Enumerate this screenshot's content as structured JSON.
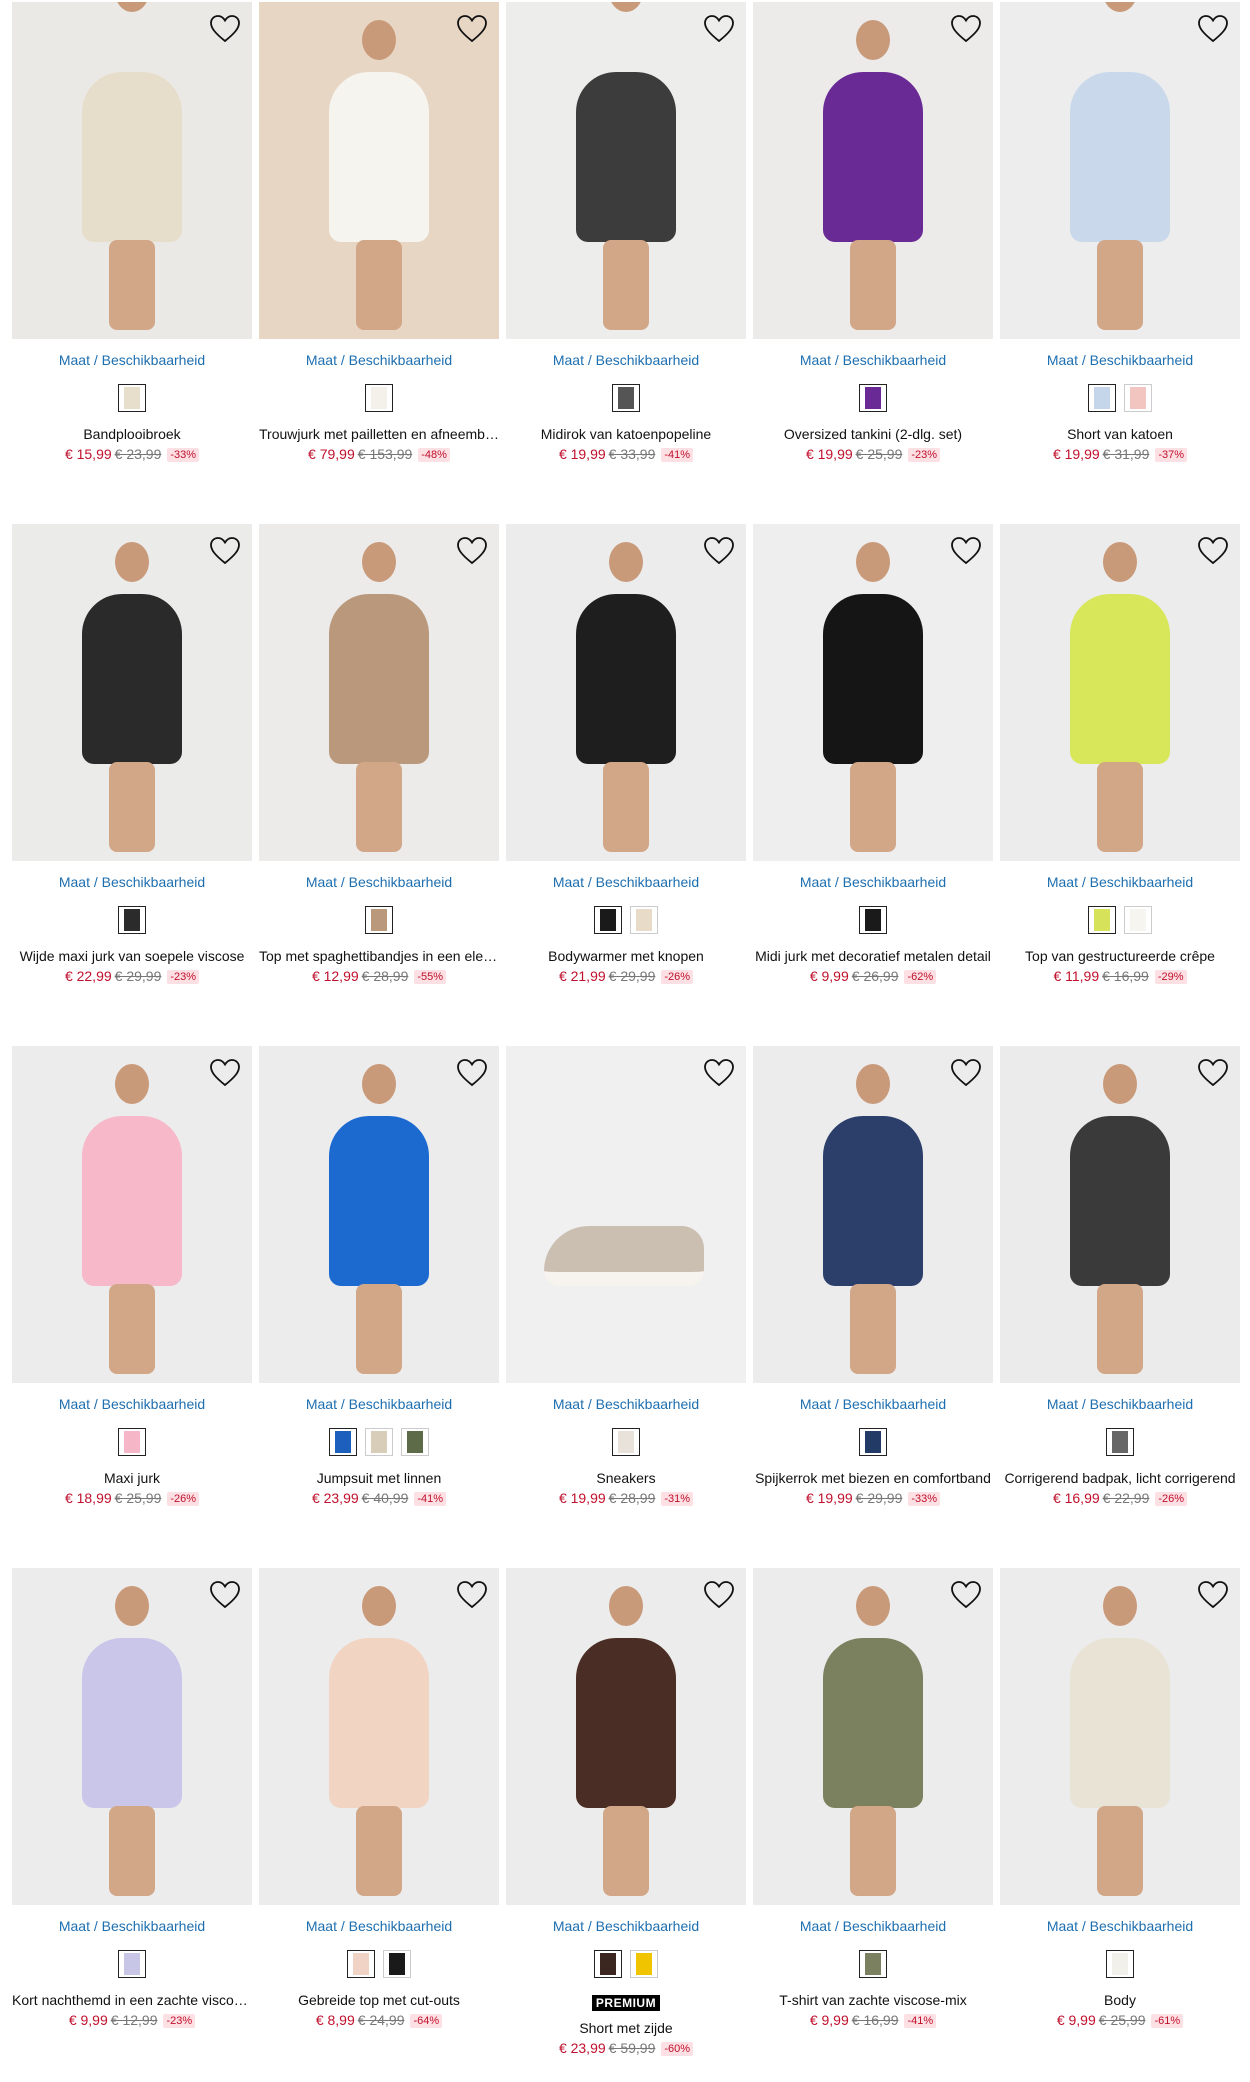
{
  "size_link_label": "Maat / Beschikbaarheid",
  "favorite_icon": "heart-outline-icon",
  "colors": {
    "price": "#c0102c",
    "old_price": "#777777",
    "discount_bg": "#fde0e3",
    "link": "#1e6fb0"
  },
  "products": [
    {
      "title": "Bandplooibroek",
      "price": "€ 15,99",
      "old_price": "€ 23,99",
      "discount": "-33%",
      "swatches": [
        "#e7dfcc"
      ],
      "photo_bg": "#ebe9e6",
      "garment": "#e6decb",
      "premium": false
    },
    {
      "title": "Trouwjurk met pailletten en afneembare rok",
      "price": "€ 79,99",
      "old_price": "€ 153,99",
      "discount": "-48%",
      "swatches": [
        "#f4f1ea"
      ],
      "photo_bg": "#e8d6c4",
      "garment": "#f6f4ee",
      "premium": false
    },
    {
      "title": "Midirok van katoenpopeline",
      "price": "€ 19,99",
      "old_price": "€ 33,99",
      "discount": "-41%",
      "swatches": [
        "#555555"
      ],
      "photo_bg": "#ededec",
      "garment": "#3c3c3c",
      "premium": false
    },
    {
      "title": "Oversized tankini (2-dlg. set)",
      "price": "€ 19,99",
      "old_price": "€ 25,99",
      "discount": "-23%",
      "swatches": [
        "#6a2a95"
      ],
      "photo_bg": "#ecebea",
      "garment": "#6a2a95",
      "premium": false
    },
    {
      "title": "Short van katoen",
      "price": "€ 19,99",
      "old_price": "€ 31,99",
      "discount": "-37%",
      "swatches": [
        "#c6d6ea",
        "#f2c5c0"
      ],
      "photo_bg": "#ededed",
      "garment": "#c9d8ea",
      "premium": false
    },
    {
      "title": "Wijde maxi jurk van soepele viscose",
      "price": "€ 22,99",
      "old_price": "€ 29,99",
      "discount": "-23%",
      "swatches": [
        "#2b2b2b"
      ],
      "photo_bg": "#ebebea",
      "garment": "#2a2a2a",
      "premium": false
    },
    {
      "title": "Top met spaghettibandjes in een elegante look",
      "price": "€ 12,99",
      "old_price": "€ 28,99",
      "discount": "-55%",
      "swatches": [
        "#b9987b"
      ],
      "photo_bg": "#ecebea",
      "garment": "#b9987b",
      "premium": false
    },
    {
      "title": "Bodywarmer met knopen",
      "price": "€ 21,99",
      "old_price": "€ 29,99",
      "discount": "-26%",
      "swatches": [
        "#1a1a1a",
        "#e8dcc8"
      ],
      "photo_bg": "#ececec",
      "garment": "#1e1e1e",
      "premium": false
    },
    {
      "title": "Midi jurk met decoratief metalen detail",
      "price": "€ 9,99",
      "old_price": "€ 26,99",
      "discount": "-62%",
      "swatches": [
        "#1a1a1a"
      ],
      "photo_bg": "#eeeeee",
      "garment": "#151515",
      "premium": false
    },
    {
      "title": "Top van gestructureerde crêpe",
      "price": "€ 11,99",
      "old_price": "€ 16,99",
      "discount": "-29%",
      "swatches": [
        "#d6e35a",
        "#f6f5f0"
      ],
      "photo_bg": "#ececec",
      "garment": "#d8e65a",
      "premium": false
    },
    {
      "title": "Maxi jurk",
      "price": "€ 18,99",
      "old_price": "€ 25,99",
      "discount": "-26%",
      "swatches": [
        "#f5b7c8"
      ],
      "photo_bg": "#ececec",
      "garment": "#f7b9ca",
      "premium": false
    },
    {
      "title": "Jumpsuit met linnen",
      "price": "€ 23,99",
      "old_price": "€ 40,99",
      "discount": "-41%",
      "swatches": [
        "#1d5fbd",
        "#d8cdb8",
        "#5e6b48"
      ],
      "photo_bg": "#ececec",
      "garment": "#1c6ad0",
      "premium": false
    },
    {
      "title": "Sneakers",
      "price": "€ 19,99",
      "old_price": "€ 28,99",
      "discount": "-31%",
      "swatches": [
        "#e8e2da"
      ],
      "photo_bg": "#f0f0f0",
      "garment": "#cbbfb2",
      "premium": false
    },
    {
      "title": "Spijkerrok met biezen en comfortband",
      "price": "€ 19,99",
      "old_price": "€ 29,99",
      "discount": "-33%",
      "swatches": [
        "#213a66"
      ],
      "photo_bg": "#ececec",
      "garment": "#2b3f6a",
      "premium": false
    },
    {
      "title": "Corrigerend badpak, licht corrigerend",
      "price": "€ 16,99",
      "old_price": "€ 22,99",
      "discount": "-26%",
      "swatches": [
        "#666666"
      ],
      "photo_bg": "#ebebeb",
      "garment": "#3a3a3a",
      "premium": false
    },
    {
      "title": "Kort nachthemd in een zachte viscose kwaliteit",
      "price": "€ 9,99",
      "old_price": "€ 12,99",
      "discount": "-23%",
      "swatches": [
        "#c8c6e6"
      ],
      "photo_bg": "#ececec",
      "garment": "#c9c6ea",
      "premium": false
    },
    {
      "title": "Gebreide top met cut-outs",
      "price": "€ 8,99",
      "old_price": "€ 24,99",
      "discount": "-64%",
      "swatches": [
        "#f0d3c4",
        "#1a1a1a"
      ],
      "photo_bg": "#ececec",
      "garment": "#f1d4c2",
      "premium": false
    },
    {
      "title": "Short met zijde",
      "price": "€ 23,99",
      "old_price": "€ 59,99",
      "discount": "-60%",
      "swatches": [
        "#3b2620",
        "#f1c400"
      ],
      "photo_bg": "#ececec",
      "garment": "#4a2d25",
      "premium": true,
      "premium_label": "PREMIUM"
    },
    {
      "title": "T-shirt van zachte viscose-mix",
      "price": "€ 9,99",
      "old_price": "€ 16,99",
      "discount": "-41%",
      "swatches": [
        "#7a8060"
      ],
      "photo_bg": "#ececec",
      "garment": "#7b805f",
      "premium": false
    },
    {
      "title": "Body",
      "price": "€ 9,99",
      "old_price": "€ 25,99",
      "discount": "-61%",
      "swatches": [
        "#f2f0ea"
      ],
      "photo_bg": "#ececec",
      "garment": "#e9e3d6",
      "premium": false
    }
  ]
}
